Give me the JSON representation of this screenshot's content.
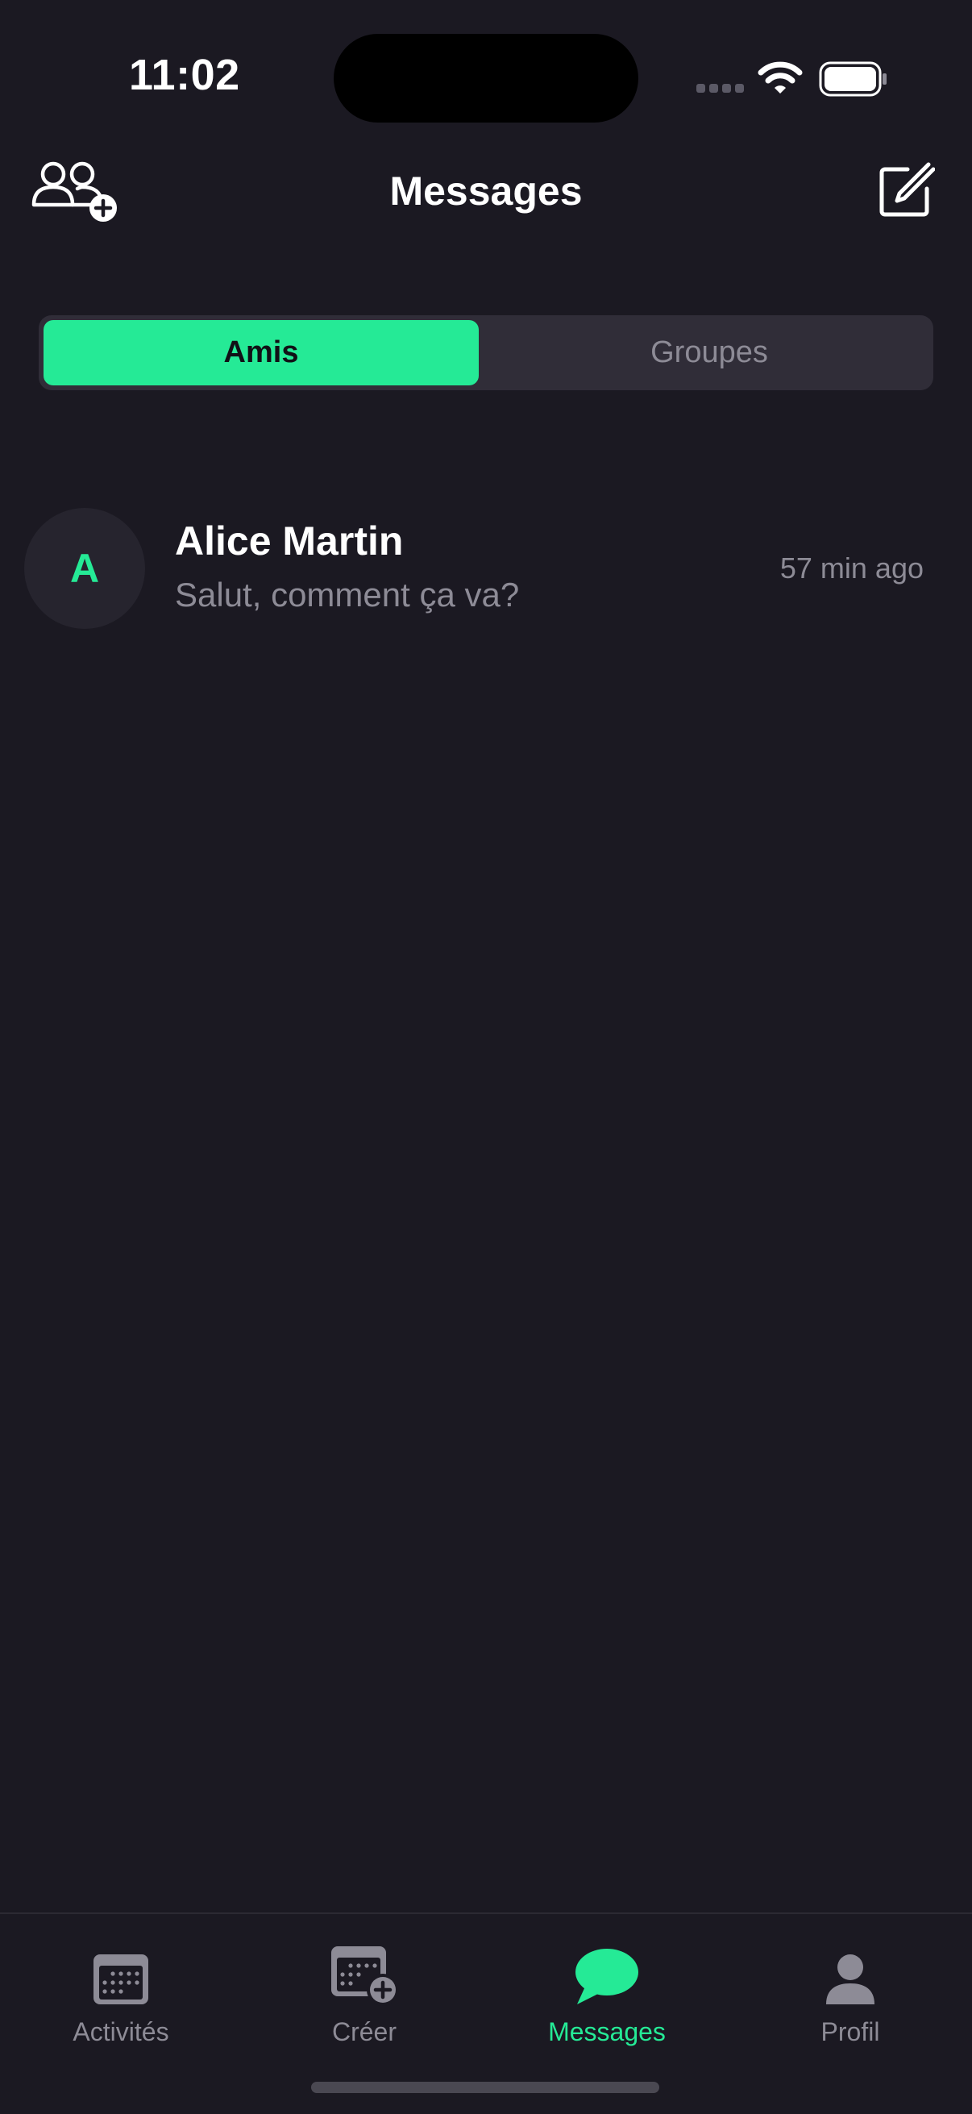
{
  "status": {
    "time": "11:02"
  },
  "header": {
    "title": "Messages",
    "left_icon": "add-friend-icon",
    "right_icon": "compose-icon"
  },
  "segments": {
    "active": "Amis",
    "inactive": "Groupes"
  },
  "conversations": [
    {
      "initial": "A",
      "name": "Alice Martin",
      "preview": "Salut, comment ça va?",
      "time": "57 min ago"
    }
  ],
  "tabbar": {
    "items": [
      {
        "label": "Activités",
        "icon": "calendar-icon",
        "active": false
      },
      {
        "label": "Créer",
        "icon": "calendar-add-icon",
        "active": false
      },
      {
        "label": "Messages",
        "icon": "chat-bubble-icon",
        "active": true
      },
      {
        "label": "Profil",
        "icon": "person-icon",
        "active": false
      }
    ]
  },
  "colors": {
    "background": "#1b1922",
    "accent": "#25ea96",
    "muted_text": "#8d8b96",
    "segment_bg": "#302d38"
  }
}
